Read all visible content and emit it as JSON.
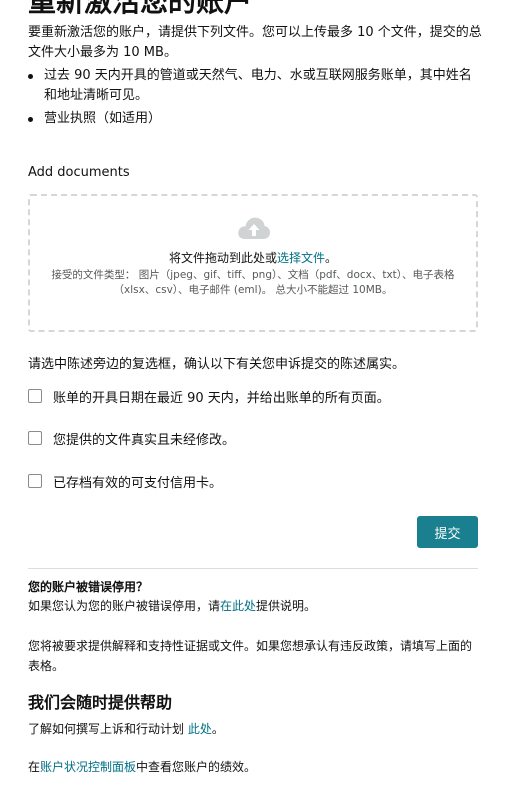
{
  "page": {
    "title": "重新激活您的账户"
  },
  "intro": {
    "text": "要重新激活您的账户，请提供下列文件。您可以上传最多 10 个文件，提交的总文件大小最多为 10 MB。",
    "bullets": [
      "过去 90 天内开具的管道或天然气、电力、水或互联网服务账单，其中姓名和地址清晰可见。",
      "营业执照（如适用）"
    ]
  },
  "upload": {
    "label": "Add documents",
    "drop_prefix": "将文件拖动到此处或",
    "drop_link": "选择文件",
    "drop_suffix": "。",
    "accepted_types": "接受的文件类型： 图片（jpeg、gif、tiff、png）、文档（pdf、docx、txt）、电子表格（xlsx、csv）、电子邮件 (eml)。 总大小不能超过 10MB。",
    "icon": "cloud-upload-icon"
  },
  "confirm": {
    "instruction": "请选中陈述旁边的复选框，确认以下有关您申诉提交的陈述属实。",
    "statements": [
      "账单的开具日期在最近 90 天内，并给出账单的所有页面。",
      "您提供的文件真实且未经修改。",
      "已存档有效的可支付信用卡。"
    ],
    "checked": [
      false,
      false,
      false
    ]
  },
  "actions": {
    "submit_label": "提交"
  },
  "wrongly_deactivated": {
    "question": "您的账户被错误停用？",
    "prefix": "如果您认为您的账户被错误停用，请",
    "link": "在此处",
    "suffix": "提供说明。"
  },
  "explanation": {
    "text": "您将被要求提供解释和支持性证据或文件。如果您想承认有违反政策，请填写上面的表格。"
  },
  "help": {
    "heading": "我们会随时提供帮助",
    "learn_prefix": "了解如何撰写上诉和行动计划 ",
    "learn_link": "此处",
    "learn_suffix": "。",
    "dashboard_prefix": "在",
    "dashboard_link": "账户状况控制面板",
    "dashboard_suffix": "中查看您账户的绩效。"
  },
  "colors": {
    "accent": "#1a8090",
    "link": "#007185",
    "border_dashed": "#d6d6d6"
  }
}
